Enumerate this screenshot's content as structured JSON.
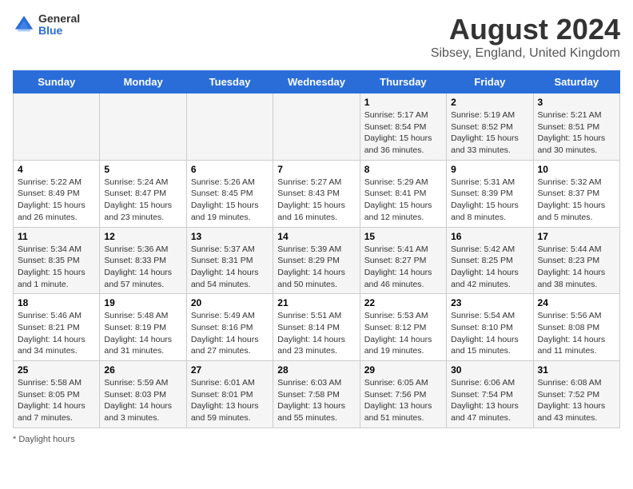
{
  "logo": {
    "general": "General",
    "blue": "Blue"
  },
  "header": {
    "title": "August 2024",
    "subtitle": "Sibsey, England, United Kingdom"
  },
  "days_of_week": [
    "Sunday",
    "Monday",
    "Tuesday",
    "Wednesday",
    "Thursday",
    "Friday",
    "Saturday"
  ],
  "footer": {
    "label": "Daylight hours"
  },
  "weeks": [
    [
      {
        "day": "",
        "info": ""
      },
      {
        "day": "",
        "info": ""
      },
      {
        "day": "",
        "info": ""
      },
      {
        "day": "",
        "info": ""
      },
      {
        "day": "1",
        "info": "Sunrise: 5:17 AM\nSunset: 8:54 PM\nDaylight: 15 hours\nand 36 minutes."
      },
      {
        "day": "2",
        "info": "Sunrise: 5:19 AM\nSunset: 8:52 PM\nDaylight: 15 hours\nand 33 minutes."
      },
      {
        "day": "3",
        "info": "Sunrise: 5:21 AM\nSunset: 8:51 PM\nDaylight: 15 hours\nand 30 minutes."
      }
    ],
    [
      {
        "day": "4",
        "info": "Sunrise: 5:22 AM\nSunset: 8:49 PM\nDaylight: 15 hours\nand 26 minutes."
      },
      {
        "day": "5",
        "info": "Sunrise: 5:24 AM\nSunset: 8:47 PM\nDaylight: 15 hours\nand 23 minutes."
      },
      {
        "day": "6",
        "info": "Sunrise: 5:26 AM\nSunset: 8:45 PM\nDaylight: 15 hours\nand 19 minutes."
      },
      {
        "day": "7",
        "info": "Sunrise: 5:27 AM\nSunset: 8:43 PM\nDaylight: 15 hours\nand 16 minutes."
      },
      {
        "day": "8",
        "info": "Sunrise: 5:29 AM\nSunset: 8:41 PM\nDaylight: 15 hours\nand 12 minutes."
      },
      {
        "day": "9",
        "info": "Sunrise: 5:31 AM\nSunset: 8:39 PM\nDaylight: 15 hours\nand 8 minutes."
      },
      {
        "day": "10",
        "info": "Sunrise: 5:32 AM\nSunset: 8:37 PM\nDaylight: 15 hours\nand 5 minutes."
      }
    ],
    [
      {
        "day": "11",
        "info": "Sunrise: 5:34 AM\nSunset: 8:35 PM\nDaylight: 15 hours\nand 1 minute."
      },
      {
        "day": "12",
        "info": "Sunrise: 5:36 AM\nSunset: 8:33 PM\nDaylight: 14 hours\nand 57 minutes."
      },
      {
        "day": "13",
        "info": "Sunrise: 5:37 AM\nSunset: 8:31 PM\nDaylight: 14 hours\nand 54 minutes."
      },
      {
        "day": "14",
        "info": "Sunrise: 5:39 AM\nSunset: 8:29 PM\nDaylight: 14 hours\nand 50 minutes."
      },
      {
        "day": "15",
        "info": "Sunrise: 5:41 AM\nSunset: 8:27 PM\nDaylight: 14 hours\nand 46 minutes."
      },
      {
        "day": "16",
        "info": "Sunrise: 5:42 AM\nSunset: 8:25 PM\nDaylight: 14 hours\nand 42 minutes."
      },
      {
        "day": "17",
        "info": "Sunrise: 5:44 AM\nSunset: 8:23 PM\nDaylight: 14 hours\nand 38 minutes."
      }
    ],
    [
      {
        "day": "18",
        "info": "Sunrise: 5:46 AM\nSunset: 8:21 PM\nDaylight: 14 hours\nand 34 minutes."
      },
      {
        "day": "19",
        "info": "Sunrise: 5:48 AM\nSunset: 8:19 PM\nDaylight: 14 hours\nand 31 minutes."
      },
      {
        "day": "20",
        "info": "Sunrise: 5:49 AM\nSunset: 8:16 PM\nDaylight: 14 hours\nand 27 minutes."
      },
      {
        "day": "21",
        "info": "Sunrise: 5:51 AM\nSunset: 8:14 PM\nDaylight: 14 hours\nand 23 minutes."
      },
      {
        "day": "22",
        "info": "Sunrise: 5:53 AM\nSunset: 8:12 PM\nDaylight: 14 hours\nand 19 minutes."
      },
      {
        "day": "23",
        "info": "Sunrise: 5:54 AM\nSunset: 8:10 PM\nDaylight: 14 hours\nand 15 minutes."
      },
      {
        "day": "24",
        "info": "Sunrise: 5:56 AM\nSunset: 8:08 PM\nDaylight: 14 hours\nand 11 minutes."
      }
    ],
    [
      {
        "day": "25",
        "info": "Sunrise: 5:58 AM\nSunset: 8:05 PM\nDaylight: 14 hours\nand 7 minutes."
      },
      {
        "day": "26",
        "info": "Sunrise: 5:59 AM\nSunset: 8:03 PM\nDaylight: 14 hours\nand 3 minutes."
      },
      {
        "day": "27",
        "info": "Sunrise: 6:01 AM\nSunset: 8:01 PM\nDaylight: 13 hours\nand 59 minutes."
      },
      {
        "day": "28",
        "info": "Sunrise: 6:03 AM\nSunset: 7:58 PM\nDaylight: 13 hours\nand 55 minutes."
      },
      {
        "day": "29",
        "info": "Sunrise: 6:05 AM\nSunset: 7:56 PM\nDaylight: 13 hours\nand 51 minutes."
      },
      {
        "day": "30",
        "info": "Sunrise: 6:06 AM\nSunset: 7:54 PM\nDaylight: 13 hours\nand 47 minutes."
      },
      {
        "day": "31",
        "info": "Sunrise: 6:08 AM\nSunset: 7:52 PM\nDaylight: 13 hours\nand 43 minutes."
      }
    ]
  ]
}
